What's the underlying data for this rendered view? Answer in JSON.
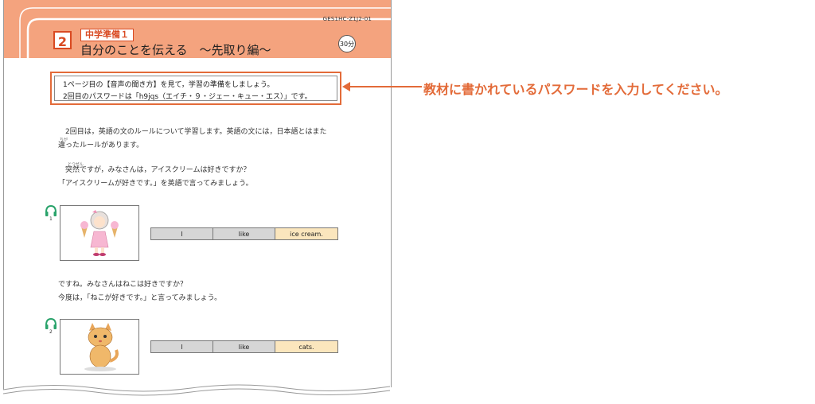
{
  "doc_code": "GES1HC-Z1J2-01",
  "lesson_number": "2",
  "category": "中学準備１",
  "title": "自分のことを伝える　～先取り編～",
  "time": "30分",
  "instructions": {
    "line1": "1ページ目の【音声の聞き方】を見て，学習の準備をしましょう。",
    "line2": "2回目のパスワードは「h9jqs（エイチ・９・ジェー・キュー・エス）」です。"
  },
  "paragraph1": {
    "line1": "　2回目は，英語の文のルールについて学習します。英語の文には，日本語とはまた",
    "line2": "違ったルールがあります。",
    "ruby": "ちが"
  },
  "paragraph2": {
    "line1": "　突然ですが，みなさんは，アイスクリームは好きですか？",
    "line2": "「アイスクリームが好きです。」を英語で言ってみましょう。",
    "ruby": "とつぜん"
  },
  "example1": {
    "track": "1",
    "words": [
      "I",
      "like",
      "ice cream."
    ]
  },
  "paragraph3": {
    "line1": "ですね。みなさんはねこは好きですか？",
    "line2": "今度は，「ねこが好きです。」と言ってみましょう。"
  },
  "example2": {
    "track": "2",
    "words": [
      "I",
      "like",
      "cats."
    ]
  },
  "callout": "教材に書かれているパスワードを入力してください。",
  "colors": {
    "header": "#f4a37e",
    "accent": "#e36b39",
    "cell_gray": "#d6d6d6",
    "cell_highlight": "#fbe6bd",
    "headphone": "#2aa36b"
  }
}
